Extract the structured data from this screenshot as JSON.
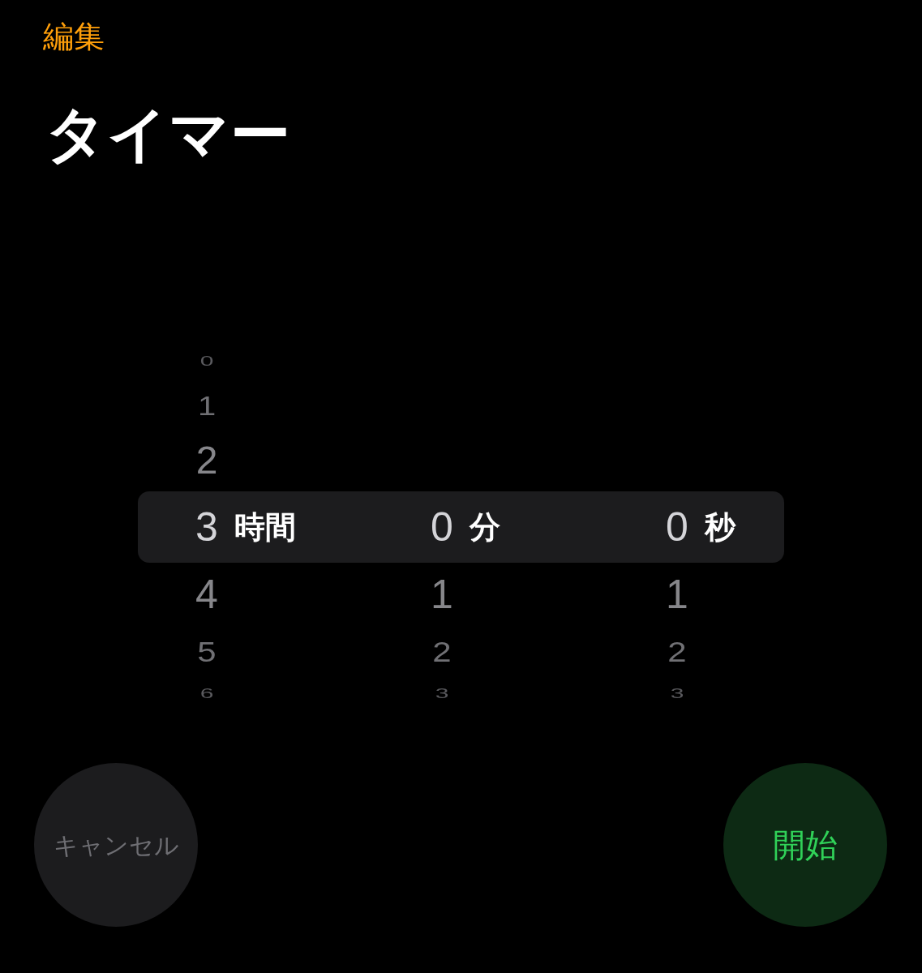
{
  "edit_button": "編集",
  "title": "タイマー",
  "picker": {
    "columns": [
      {
        "unit": "時間",
        "above": [
          "0",
          "1",
          "2"
        ],
        "value": "3",
        "below": [
          "4",
          "5",
          "6"
        ]
      },
      {
        "unit": "分",
        "value": "0",
        "below": [
          "1",
          "2",
          "3"
        ]
      },
      {
        "unit": "秒",
        "value": "0",
        "below": [
          "1",
          "2",
          "3"
        ]
      }
    ]
  },
  "cancel_button": "キャンセル",
  "start_button": "開始"
}
